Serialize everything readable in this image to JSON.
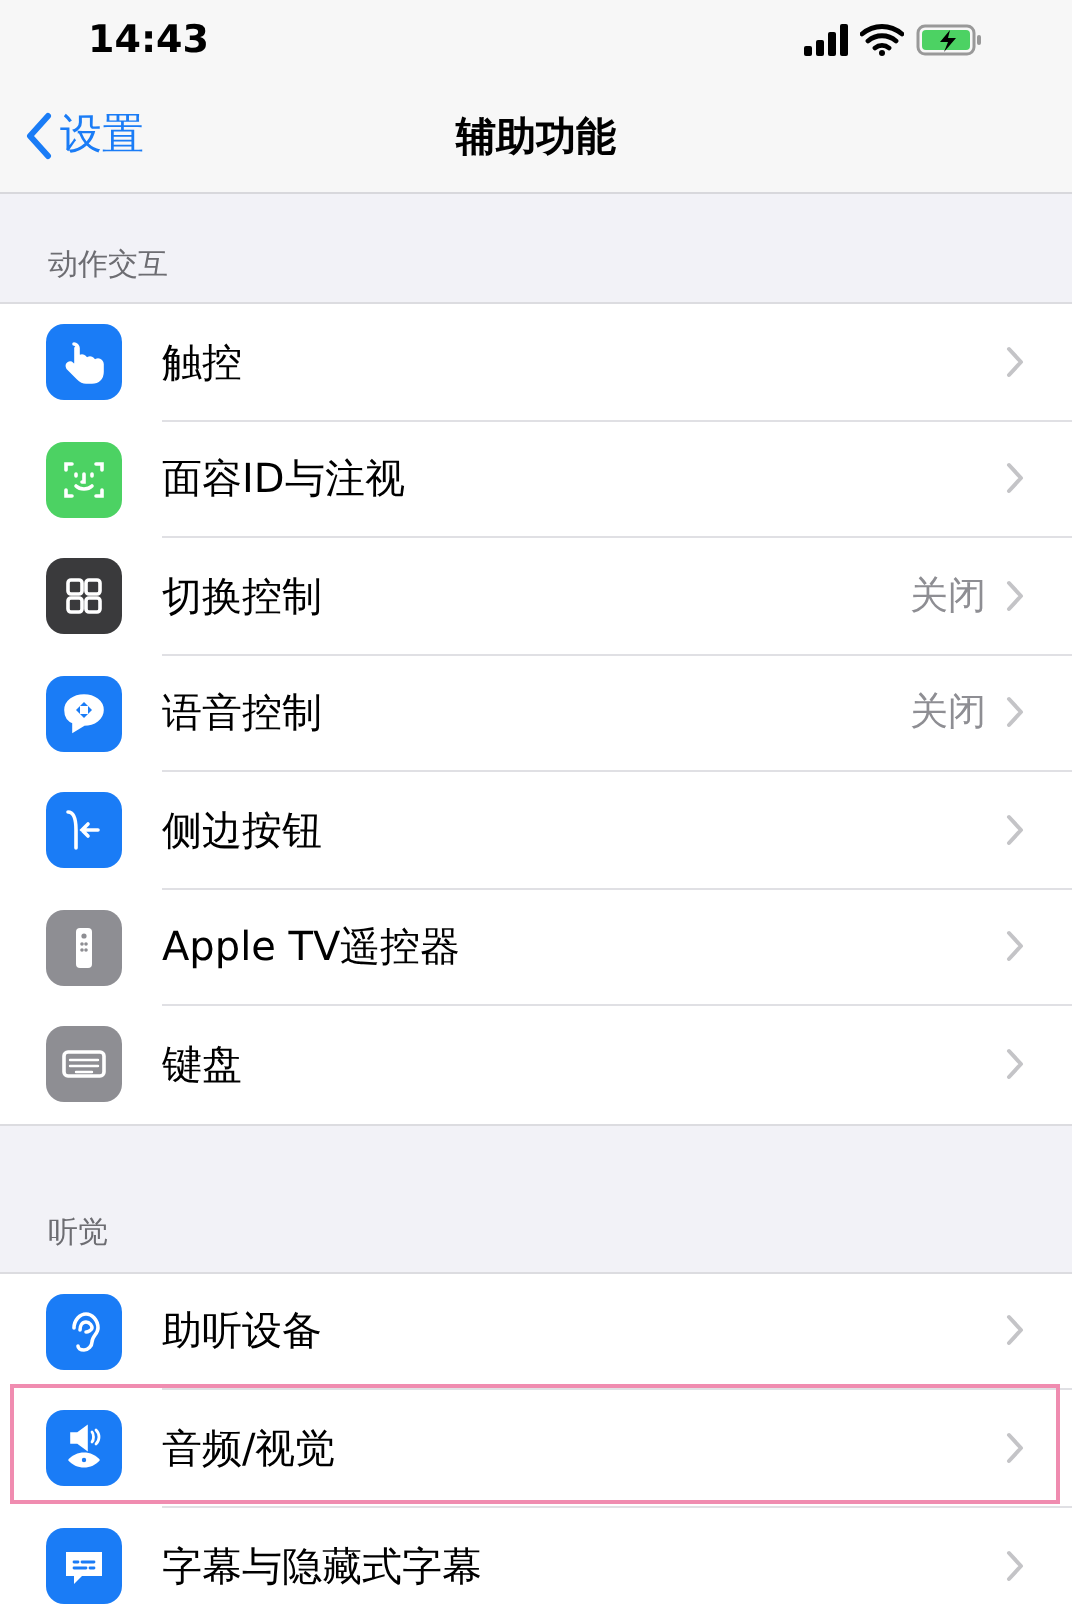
{
  "status_bar": {
    "time": "14:43"
  },
  "nav": {
    "back": "设置",
    "title": "辅助功能"
  },
  "sections": [
    {
      "header": "动作交互",
      "items": [
        {
          "label": "触控",
          "color": "#1a7cf6",
          "highlighted": false
        },
        {
          "label": "面容ID与注视",
          "color": "#4cd263",
          "highlighted": false
        },
        {
          "label": "切换控制",
          "value": "关闭",
          "color": "#3a3a3c",
          "highlighted": false
        },
        {
          "label": "语音控制",
          "value": "关闭",
          "color": "#1a7cf6",
          "highlighted": false
        },
        {
          "label": "侧边按钮",
          "color": "#1a7cf6",
          "highlighted": false
        },
        {
          "label": "Apple TV遥控器",
          "color": "#8e8e93",
          "highlighted": false
        },
        {
          "label": "键盘",
          "color": "#8e8e93",
          "highlighted": false
        }
      ]
    },
    {
      "header": "听觉",
      "items": [
        {
          "label": "助听设备",
          "color": "#1a7cf6",
          "highlighted": false
        },
        {
          "label": "音频/视觉",
          "color": "#1a7cf6",
          "highlighted": true
        },
        {
          "label": "字幕与隐藏式字幕",
          "color": "#1a7cf6",
          "highlighted": false
        }
      ]
    }
  ]
}
